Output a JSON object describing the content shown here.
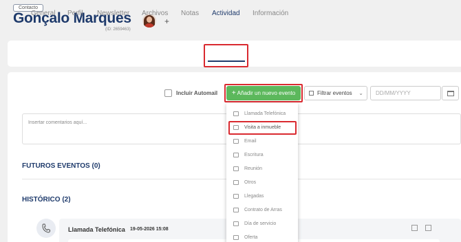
{
  "header": {
    "badge": "Contacto",
    "name": "Gonçalo Marques",
    "id_label": "(ID: 2659463)",
    "add_symbol": "+"
  },
  "tabs": [
    {
      "label": "General"
    },
    {
      "label": "Perfil"
    },
    {
      "label": "Newsletter"
    },
    {
      "label": "Archivos"
    },
    {
      "label": "Notas"
    },
    {
      "label": "Actividad",
      "active": true
    },
    {
      "label": "Información"
    }
  ],
  "toolbar": {
    "include_automail": "Incluir Automail",
    "add_event": "Añadir un nuevo evento",
    "filter": "Filtrar eventos",
    "date_placeholder": "DD/MM/YYYY"
  },
  "comments_placeholder": "Insertar comentarios aquí...",
  "sections": {
    "future": "FUTUROS EVENTOS (0)",
    "history": "HISTÓRICO (2)"
  },
  "event": {
    "title": "Llamada Telefónica",
    "date": "19-05-2026 15:08"
  },
  "dropdown": {
    "items": [
      {
        "label": "Llamada Telefónica",
        "icon": "phone-icon"
      },
      {
        "label": "Visita a inmueble",
        "icon": "house-icon",
        "selected": true
      },
      {
        "label": "Email",
        "icon": "email-icon"
      },
      {
        "label": "Escritura",
        "icon": "document-icon"
      },
      {
        "label": "Reunión",
        "icon": "people-icon"
      },
      {
        "label": "Otros",
        "icon": "more-icon"
      },
      {
        "label": "Llegadas",
        "icon": "arrival-icon"
      },
      {
        "label": "Contrato de Arras",
        "icon": "contract-icon"
      },
      {
        "label": "Día de servicio",
        "icon": "calendar-icon"
      },
      {
        "label": "Oferta",
        "icon": "pin-icon"
      }
    ]
  },
  "colors": {
    "primary": "#1e3a6b",
    "success": "#5cb85c",
    "highlight": "#d9292f"
  }
}
